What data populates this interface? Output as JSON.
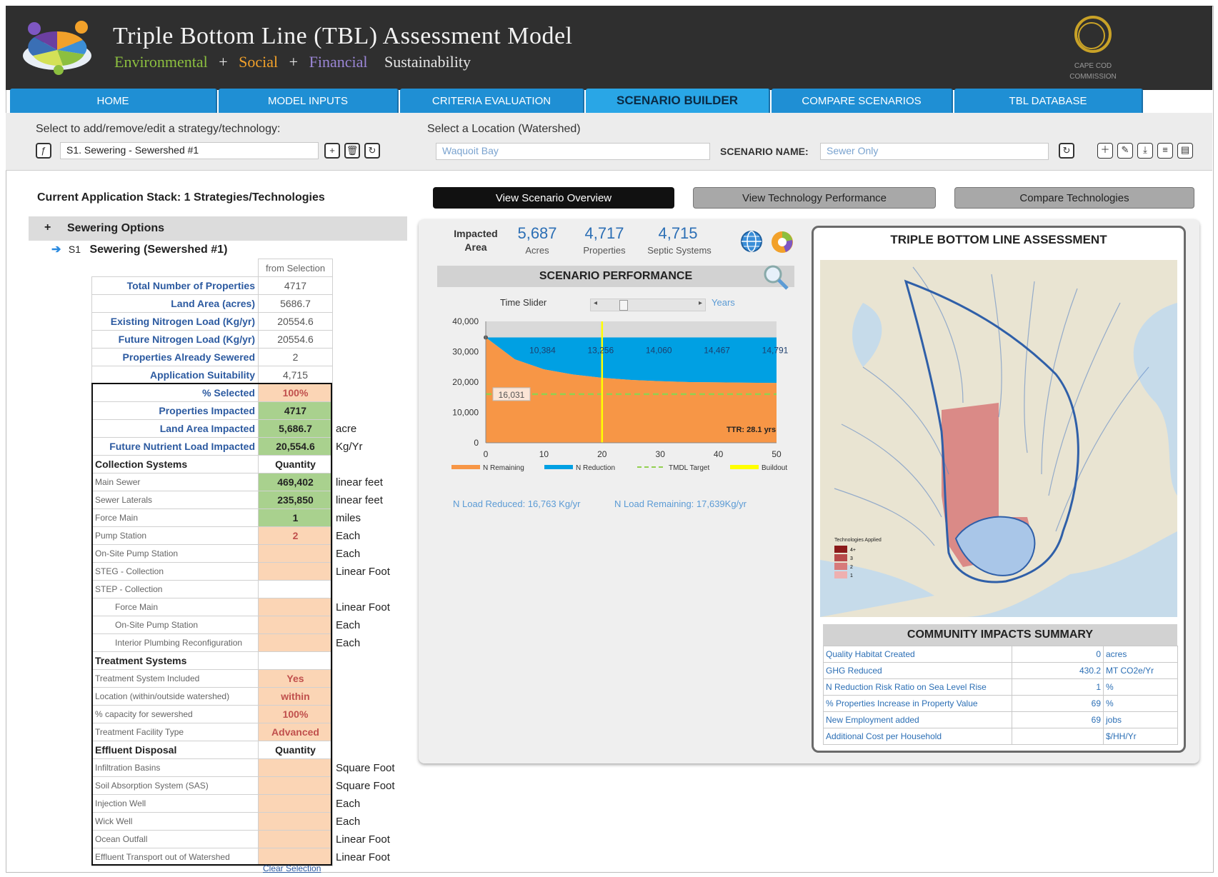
{
  "header": {
    "title": "Triple Bottom Line (TBL) Assessment Model",
    "subtitle": [
      {
        "text": "Environmental",
        "color": "#8cbf3f"
      },
      {
        "text": "+",
        "color": "#e6e6e6"
      },
      {
        "text": "Social",
        "color": "#f2a12a"
      },
      {
        "text": "+",
        "color": "#e6e6e6"
      },
      {
        "text": "Financial",
        "color": "#9b86d6"
      },
      {
        "text": "Sustainability",
        "color": "#e6e6e6"
      }
    ],
    "org_logo_text_1": "CAPE COD",
    "org_logo_text_2": "COMMISSION"
  },
  "nav": {
    "tabs": [
      "HOME",
      "MODEL INPUTS",
      "CRITERIA EVALUATION",
      "SCENARIO BUILDER",
      "COMPARE SCENARIOS",
      "TBL DATABASE"
    ],
    "active": "SCENARIO BUILDER"
  },
  "toolbar": {
    "strategy_label": "Select to add/remove/edit  a strategy/technology:",
    "strategy_value": "S1. Sewering - Sewershed #1",
    "location_label": "Select a Location (Watershed)",
    "location_value": "Waquoit Bay",
    "scenario_name_label": "SCENARIO NAME:",
    "scenario_name_value": "Sewer Only"
  },
  "left": {
    "stack_title": "Current Application Stack: 1 Strategies/Technologies",
    "group_toggle": "+",
    "group_label": "Sewering Options",
    "s1_code": "S1",
    "s1_label": "Sewering (Sewershed #1)",
    "from_selection": "from Selection",
    "clear_selection": "Clear Selection",
    "rows": [
      {
        "label": "Total Number of Properties",
        "value": "4717",
        "unit": "",
        "style": "blue",
        "vstyle": "plain"
      },
      {
        "label": "Land Area (acres)",
        "value": "5686.7",
        "unit": "",
        "style": "blue",
        "vstyle": "plain"
      },
      {
        "label": "Existing Nitrogen Load (Kg/yr)",
        "value": "20554.6",
        "unit": "",
        "style": "blue",
        "vstyle": "plain"
      },
      {
        "label": "Future Nitrogen Load (Kg/yr)",
        "value": "20554.6",
        "unit": "",
        "style": "blue",
        "vstyle": "plain"
      },
      {
        "label": "Properties Already Sewered",
        "value": "2",
        "unit": "",
        "style": "blue",
        "vstyle": "plain"
      },
      {
        "label": "Application Suitability",
        "value": "4,715",
        "unit": "",
        "style": "blue",
        "vstyle": "plain"
      },
      {
        "label": "% Selected",
        "value": "100%",
        "unit": "",
        "style": "blue",
        "vstyle": "orange"
      },
      {
        "label": "Properties Impacted",
        "value": "4717",
        "unit": "",
        "style": "blue",
        "vstyle": "green"
      },
      {
        "label": "Land Area Impacted",
        "value": "5,686.7",
        "unit": "acre",
        "style": "blue",
        "vstyle": "green"
      },
      {
        "label": "Future Nutrient Load Impacted",
        "value": "20,554.6",
        "unit": "Kg/Yr",
        "style": "blue",
        "vstyle": "green"
      },
      {
        "label": "Collection Systems",
        "value": "Quantity",
        "unit": "",
        "style": "head",
        "vstyle": "head"
      },
      {
        "label": "Main Sewer",
        "value": "469,402",
        "unit": "linear feet",
        "style": "gray",
        "vstyle": "green"
      },
      {
        "label": "Sewer Laterals",
        "value": "235,850",
        "unit": "linear feet",
        "style": "gray",
        "vstyle": "green"
      },
      {
        "label": "Force Main",
        "value": "1",
        "unit": "miles",
        "style": "gray",
        "vstyle": "green"
      },
      {
        "label": "Pump Station",
        "value": "2",
        "unit": "Each",
        "style": "gray",
        "vstyle": "orange"
      },
      {
        "label": "On-Site Pump Station",
        "value": "",
        "unit": "Each",
        "style": "gray",
        "vstyle": "orange"
      },
      {
        "label": "STEG - Collection",
        "value": "",
        "unit": "Linear Foot",
        "style": "gray",
        "vstyle": "orange"
      },
      {
        "label": "STEP - Collection",
        "value": "",
        "unit": "",
        "style": "gray",
        "vstyle": "plain"
      },
      {
        "label": "Force Main",
        "value": "",
        "unit": "Linear Foot",
        "style": "gray-indent",
        "vstyle": "orange"
      },
      {
        "label": "On-Site Pump Station",
        "value": "",
        "unit": "Each",
        "style": "gray-indent",
        "vstyle": "orange"
      },
      {
        "label": "Interior Plumbing Reconfiguration",
        "value": "",
        "unit": "Each",
        "style": "gray-indent",
        "vstyle": "orange"
      },
      {
        "label": "Treatment Systems",
        "value": "",
        "unit": "",
        "style": "head",
        "vstyle": "plain"
      },
      {
        "label": "Treatment System Included",
        "value": "Yes",
        "unit": "",
        "style": "gray",
        "vstyle": "orange"
      },
      {
        "label": "Location (within/outside watershed)",
        "value": "within",
        "unit": "",
        "style": "gray",
        "vstyle": "orange"
      },
      {
        "label": "% capacity for sewershed",
        "value": "100%",
        "unit": "",
        "style": "gray",
        "vstyle": "orange"
      },
      {
        "label": "Treatment Facility Type",
        "value": "Advanced",
        "unit": "",
        "style": "gray",
        "vstyle": "orange"
      },
      {
        "label": "Effluent Disposal",
        "value": "Quantity",
        "unit": "",
        "style": "head",
        "vstyle": "head"
      },
      {
        "label": "Infiltration Basins",
        "value": "",
        "unit": "Square Foot",
        "style": "gray",
        "vstyle": "orange"
      },
      {
        "label": "Soil Absorption System (SAS)",
        "value": "",
        "unit": "Square Foot",
        "style": "gray",
        "vstyle": "orange"
      },
      {
        "label": "Injection Well",
        "value": "",
        "unit": "Each",
        "style": "gray",
        "vstyle": "orange"
      },
      {
        "label": "Wick Well",
        "value": "",
        "unit": "Each",
        "style": "gray",
        "vstyle": "orange"
      },
      {
        "label": "Ocean Outfall",
        "value": "",
        "unit": "Linear Foot",
        "style": "gray",
        "vstyle": "orange"
      },
      {
        "label": "Effluent Transport out of Watershed",
        "value": "",
        "unit": "Linear Foot",
        "style": "gray",
        "vstyle": "orange"
      }
    ]
  },
  "view_buttons": [
    "View Scenario Overview",
    "View Technology Performance",
    "Compare Technologies"
  ],
  "impacted": {
    "label_1": "Impacted",
    "label_2": "Area",
    "items": [
      {
        "num": "5,687",
        "unit": "Acres"
      },
      {
        "num": "4,717",
        "unit": "Properties"
      },
      {
        "num": "4,715",
        "unit": "Septic Systems"
      }
    ]
  },
  "performance": {
    "title": "SCENARIO PERFORMANCE",
    "time_slider_label": "Time Slider",
    "years_label": "Years",
    "n_load_reduced": "N Load Reduced: 16,763 Kg/yr",
    "n_load_remaining": "N Load Remaining: 17,639Kg/yr"
  },
  "chart_data": {
    "type": "area",
    "x": [
      0,
      5,
      10,
      15,
      20,
      25,
      30,
      35,
      40,
      45,
      50
    ],
    "series": [
      {
        "name": "N Remaining",
        "color": "#f79646",
        "values": [
          34700,
          27500,
          24200,
          22500,
          21400,
          20700,
          20300,
          20000,
          19900,
          19800,
          19700
        ]
      },
      {
        "name": "N Reduction",
        "color": "#00a0e3",
        "top": [
          34700,
          34700,
          34700,
          34700,
          34700,
          34700,
          34700,
          34700,
          34700,
          34700,
          34700
        ]
      }
    ],
    "tmdl_target": {
      "name": "TMDL Target",
      "value": 16031,
      "color": "#92d050"
    },
    "buildout": {
      "name": "Buildout",
      "x": 20,
      "color": "#ffff00"
    },
    "reduction_labels": [
      {
        "x": 10,
        "text": "10,384"
      },
      {
        "x": 20,
        "text": "13,256"
      },
      {
        "x": 30,
        "text": "14,060"
      },
      {
        "x": 40,
        "text": "14,467"
      },
      {
        "x": 50,
        "text": "14,791"
      }
    ],
    "target_label": "16,031",
    "ttr_label": "TTR: 28.1 yrs",
    "ylim": [
      0,
      40000
    ],
    "yticks": [
      "0",
      "10,000",
      "20,000",
      "30,000",
      "40,000"
    ],
    "xticks": [
      "0",
      "10",
      "20",
      "30",
      "40",
      "50"
    ],
    "xlim": [
      0,
      50
    ]
  },
  "tbl": {
    "title": "TRIPLE BOTTOM LINE ASSESSMENT",
    "legend_title": "Technologies Applied",
    "legend_items": [
      "4+",
      "3",
      "2",
      "1"
    ],
    "community_title": "COMMUNITY IMPACTS SUMMARY",
    "community_rows": [
      {
        "label": "Quality Habitat Created",
        "value": "0",
        "unit": "acres"
      },
      {
        "label": "GHG Reduced",
        "value": "430.2",
        "unit": "MT CO2e/Yr"
      },
      {
        "label": "N Reduction Risk Ratio on Sea Level Rise",
        "value": "1",
        "unit": "%"
      },
      {
        "label": "% Properties Increase in Property Value",
        "value": "69",
        "unit": "%"
      },
      {
        "label": "New Employment added",
        "value": "69",
        "unit": "jobs"
      },
      {
        "label": "Additional Cost per Household",
        "value": "",
        "unit": "$/HH/Yr"
      }
    ]
  }
}
